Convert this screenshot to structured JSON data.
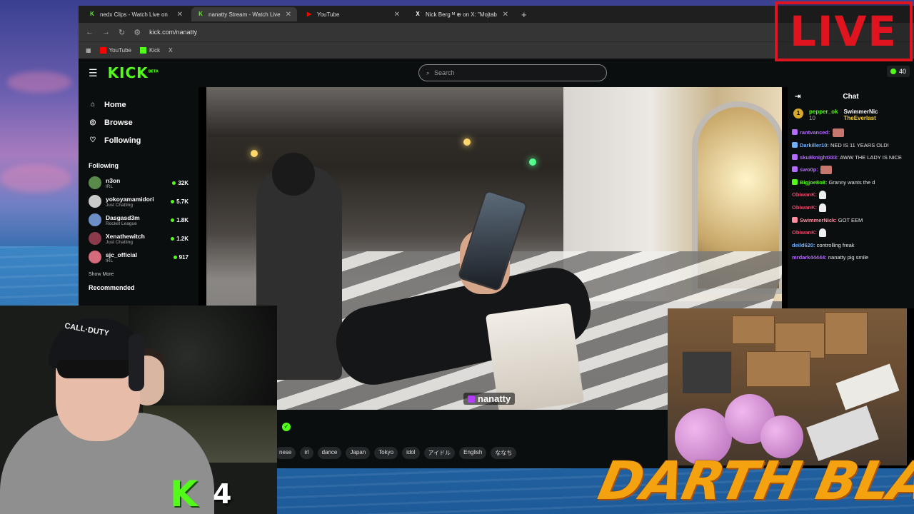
{
  "browser": {
    "tabs": [
      {
        "title": "nedx Clips - Watch Live on",
        "favicon": "K",
        "color": "#53fc18"
      },
      {
        "title": "nanatty Stream - Watch Live o",
        "favicon": "K",
        "color": "#53fc18"
      },
      {
        "title": "YouTube",
        "favicon": "▶",
        "color": "#ff0000"
      },
      {
        "title": "Nick Berg ᴹ ⊕ on X: \"Mojtab",
        "favicon": "X",
        "color": "#ffffff"
      }
    ],
    "url": "kick.com/nanatty",
    "bookmarks": [
      {
        "label": "YouTube",
        "color": "#ff0000"
      },
      {
        "label": "Kick",
        "color": "#53fc18"
      },
      {
        "label": "X",
        "color": "#ffffff"
      }
    ],
    "ask_gemini": "Ask Gemini"
  },
  "kick": {
    "logo": "KICK",
    "beta": "BETA",
    "search_placeholder": "Search",
    "viewer_badge": "40",
    "nav": [
      {
        "label": "Home",
        "icon": "home-icon"
      },
      {
        "label": "Browse",
        "icon": "compass-icon"
      },
      {
        "label": "Following",
        "icon": "heart-icon"
      }
    ],
    "following_title": "Following",
    "following": [
      {
        "name": "n3on",
        "category": "IRL",
        "viewers": "32K",
        "color": "#5a8a4a"
      },
      {
        "name": "yokoyamamidori",
        "category": "Just Chatting",
        "viewers": "5.7K",
        "color": "#c9c9c9"
      },
      {
        "name": "Dasgasd3m",
        "category": "Rocket League",
        "viewers": "1.8K",
        "color": "#6b8fc4"
      },
      {
        "name": "Xenathewitch",
        "category": "Just Chatting",
        "viewers": "1.2K",
        "color": "#8a3a4a"
      },
      {
        "name": "sjc_official",
        "category": "IRL",
        "viewers": "917",
        "color": "#d46a7a"
      }
    ],
    "show_more": "Show More",
    "recommended": "Recommended",
    "streamer_overlay": "nanatty",
    "tags": [
      "nese",
      "irl",
      "dance",
      "Japan",
      "Tokyo",
      "idol",
      "アイドル",
      "English",
      "ななち"
    ]
  },
  "chat": {
    "title": "Chat",
    "pinned": [
      {
        "user": "pepper_ok",
        "sub": "10"
      },
      {
        "user": "SwimmerNic"
      },
      {
        "user": "TheEverlast"
      }
    ],
    "messages": [
      {
        "user": "rantvanced:",
        "text": "",
        "color": "#b46bff",
        "emote": true
      },
      {
        "user": "Darkiller10:",
        "text": "NED IS 11 YEARS OLD!",
        "color": "#6fb0ff"
      },
      {
        "user": "sku8knight333:",
        "text": "AWW THE LADY IS NICE",
        "color": "#b46bff"
      },
      {
        "user": "swo0p:",
        "text": "",
        "color": "#b46bff",
        "emote": true
      },
      {
        "user": "Bigjoe8o8:",
        "text": "Granny wants the d",
        "color": "#53fc18"
      },
      {
        "user": "ObiwanK:",
        "text": "",
        "color": "#e04a6a",
        "ghost": true
      },
      {
        "user": "ObiwanK:",
        "text": "",
        "color": "#e04a6a",
        "ghost": true
      },
      {
        "user": "SwimmerNick:",
        "text": "GOT EEM",
        "color": "#ff8fa0"
      },
      {
        "user": "ObiwanK:",
        "text": "",
        "color": "#e04a6a",
        "ghost": true
      },
      {
        "user": "deild620:",
        "text": "controlling freak",
        "color": "#6fb0ff"
      },
      {
        "user": "mrdark44444:",
        "text": "nanatty pig smile",
        "color": "#b46bff"
      }
    ]
  },
  "overlay": {
    "live": "LIVE",
    "kick_viewers": "4",
    "brand": "DARTH BLAZE",
    "cap_text": "CALL·DUTY"
  }
}
